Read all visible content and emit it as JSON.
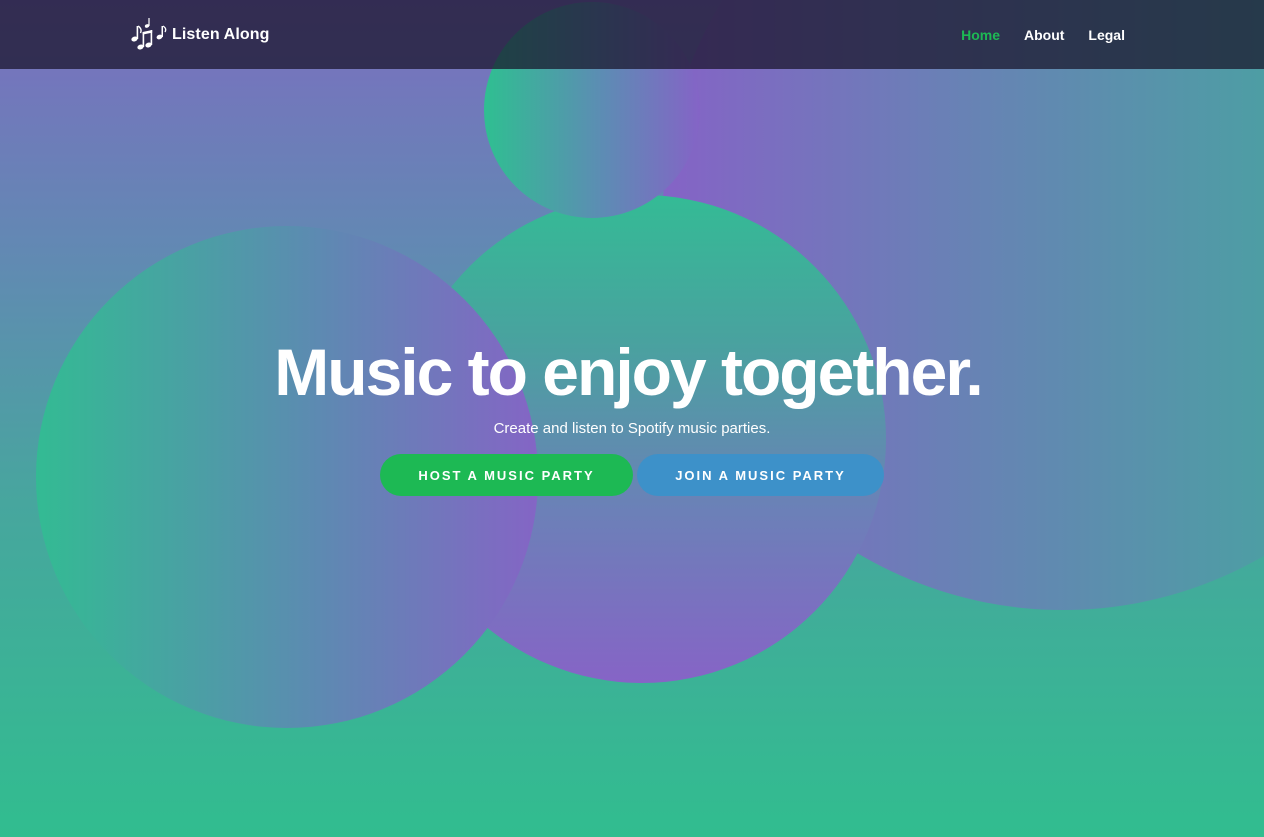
{
  "brand": {
    "name": "Listen Along",
    "icon": "music-notes-icon"
  },
  "nav": {
    "items": [
      {
        "label": "Home",
        "active": true
      },
      {
        "label": "About",
        "active": false
      },
      {
        "label": "Legal",
        "active": false
      }
    ]
  },
  "hero": {
    "title": "Music to enjoy together.",
    "subtitle": "Create and listen to Spotify music parties.",
    "host_button": "HOST A MUSIC PARTY",
    "join_button": "JOIN A MUSIC PARTY"
  },
  "colors": {
    "accent_green": "#1db954",
    "accent_blue": "#3d91c9",
    "nav_background": "#181428",
    "bg_purple": "#7b6ec0",
    "bg_green": "#31bd8f"
  }
}
